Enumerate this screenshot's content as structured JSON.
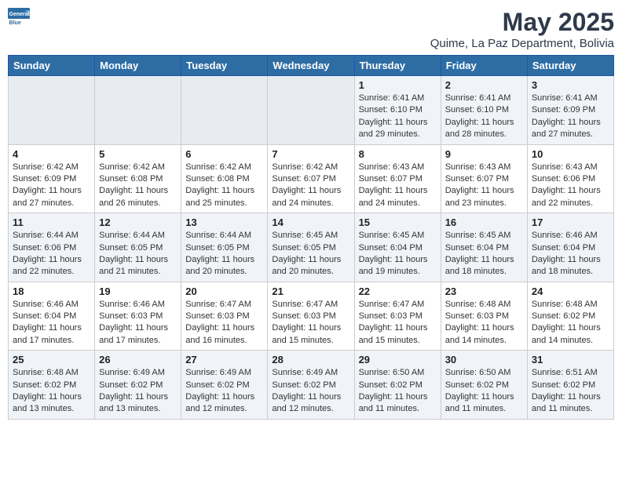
{
  "logo": {
    "general": "General",
    "blue": "Blue"
  },
  "header": {
    "month": "May 2025",
    "location": "Quime, La Paz Department, Bolivia"
  },
  "weekdays": [
    "Sunday",
    "Monday",
    "Tuesday",
    "Wednesday",
    "Thursday",
    "Friday",
    "Saturday"
  ],
  "weeks": [
    [
      {
        "day": "",
        "info": ""
      },
      {
        "day": "",
        "info": ""
      },
      {
        "day": "",
        "info": ""
      },
      {
        "day": "",
        "info": ""
      },
      {
        "day": "1",
        "info": "Sunrise: 6:41 AM\nSunset: 6:10 PM\nDaylight: 11 hours and 29 minutes."
      },
      {
        "day": "2",
        "info": "Sunrise: 6:41 AM\nSunset: 6:10 PM\nDaylight: 11 hours and 28 minutes."
      },
      {
        "day": "3",
        "info": "Sunrise: 6:41 AM\nSunset: 6:09 PM\nDaylight: 11 hours and 27 minutes."
      }
    ],
    [
      {
        "day": "4",
        "info": "Sunrise: 6:42 AM\nSunset: 6:09 PM\nDaylight: 11 hours and 27 minutes."
      },
      {
        "day": "5",
        "info": "Sunrise: 6:42 AM\nSunset: 6:08 PM\nDaylight: 11 hours and 26 minutes."
      },
      {
        "day": "6",
        "info": "Sunrise: 6:42 AM\nSunset: 6:08 PM\nDaylight: 11 hours and 25 minutes."
      },
      {
        "day": "7",
        "info": "Sunrise: 6:42 AM\nSunset: 6:07 PM\nDaylight: 11 hours and 24 minutes."
      },
      {
        "day": "8",
        "info": "Sunrise: 6:43 AM\nSunset: 6:07 PM\nDaylight: 11 hours and 24 minutes."
      },
      {
        "day": "9",
        "info": "Sunrise: 6:43 AM\nSunset: 6:07 PM\nDaylight: 11 hours and 23 minutes."
      },
      {
        "day": "10",
        "info": "Sunrise: 6:43 AM\nSunset: 6:06 PM\nDaylight: 11 hours and 22 minutes."
      }
    ],
    [
      {
        "day": "11",
        "info": "Sunrise: 6:44 AM\nSunset: 6:06 PM\nDaylight: 11 hours and 22 minutes."
      },
      {
        "day": "12",
        "info": "Sunrise: 6:44 AM\nSunset: 6:05 PM\nDaylight: 11 hours and 21 minutes."
      },
      {
        "day": "13",
        "info": "Sunrise: 6:44 AM\nSunset: 6:05 PM\nDaylight: 11 hours and 20 minutes."
      },
      {
        "day": "14",
        "info": "Sunrise: 6:45 AM\nSunset: 6:05 PM\nDaylight: 11 hours and 20 minutes."
      },
      {
        "day": "15",
        "info": "Sunrise: 6:45 AM\nSunset: 6:04 PM\nDaylight: 11 hours and 19 minutes."
      },
      {
        "day": "16",
        "info": "Sunrise: 6:45 AM\nSunset: 6:04 PM\nDaylight: 11 hours and 18 minutes."
      },
      {
        "day": "17",
        "info": "Sunrise: 6:46 AM\nSunset: 6:04 PM\nDaylight: 11 hours and 18 minutes."
      }
    ],
    [
      {
        "day": "18",
        "info": "Sunrise: 6:46 AM\nSunset: 6:04 PM\nDaylight: 11 hours and 17 minutes."
      },
      {
        "day": "19",
        "info": "Sunrise: 6:46 AM\nSunset: 6:03 PM\nDaylight: 11 hours and 17 minutes."
      },
      {
        "day": "20",
        "info": "Sunrise: 6:47 AM\nSunset: 6:03 PM\nDaylight: 11 hours and 16 minutes."
      },
      {
        "day": "21",
        "info": "Sunrise: 6:47 AM\nSunset: 6:03 PM\nDaylight: 11 hours and 15 minutes."
      },
      {
        "day": "22",
        "info": "Sunrise: 6:47 AM\nSunset: 6:03 PM\nDaylight: 11 hours and 15 minutes."
      },
      {
        "day": "23",
        "info": "Sunrise: 6:48 AM\nSunset: 6:03 PM\nDaylight: 11 hours and 14 minutes."
      },
      {
        "day": "24",
        "info": "Sunrise: 6:48 AM\nSunset: 6:02 PM\nDaylight: 11 hours and 14 minutes."
      }
    ],
    [
      {
        "day": "25",
        "info": "Sunrise: 6:48 AM\nSunset: 6:02 PM\nDaylight: 11 hours and 13 minutes."
      },
      {
        "day": "26",
        "info": "Sunrise: 6:49 AM\nSunset: 6:02 PM\nDaylight: 11 hours and 13 minutes."
      },
      {
        "day": "27",
        "info": "Sunrise: 6:49 AM\nSunset: 6:02 PM\nDaylight: 11 hours and 12 minutes."
      },
      {
        "day": "28",
        "info": "Sunrise: 6:49 AM\nSunset: 6:02 PM\nDaylight: 11 hours and 12 minutes."
      },
      {
        "day": "29",
        "info": "Sunrise: 6:50 AM\nSunset: 6:02 PM\nDaylight: 11 hours and 11 minutes."
      },
      {
        "day": "30",
        "info": "Sunrise: 6:50 AM\nSunset: 6:02 PM\nDaylight: 11 hours and 11 minutes."
      },
      {
        "day": "31",
        "info": "Sunrise: 6:51 AM\nSunset: 6:02 PM\nDaylight: 11 hours and 11 minutes."
      }
    ]
  ]
}
